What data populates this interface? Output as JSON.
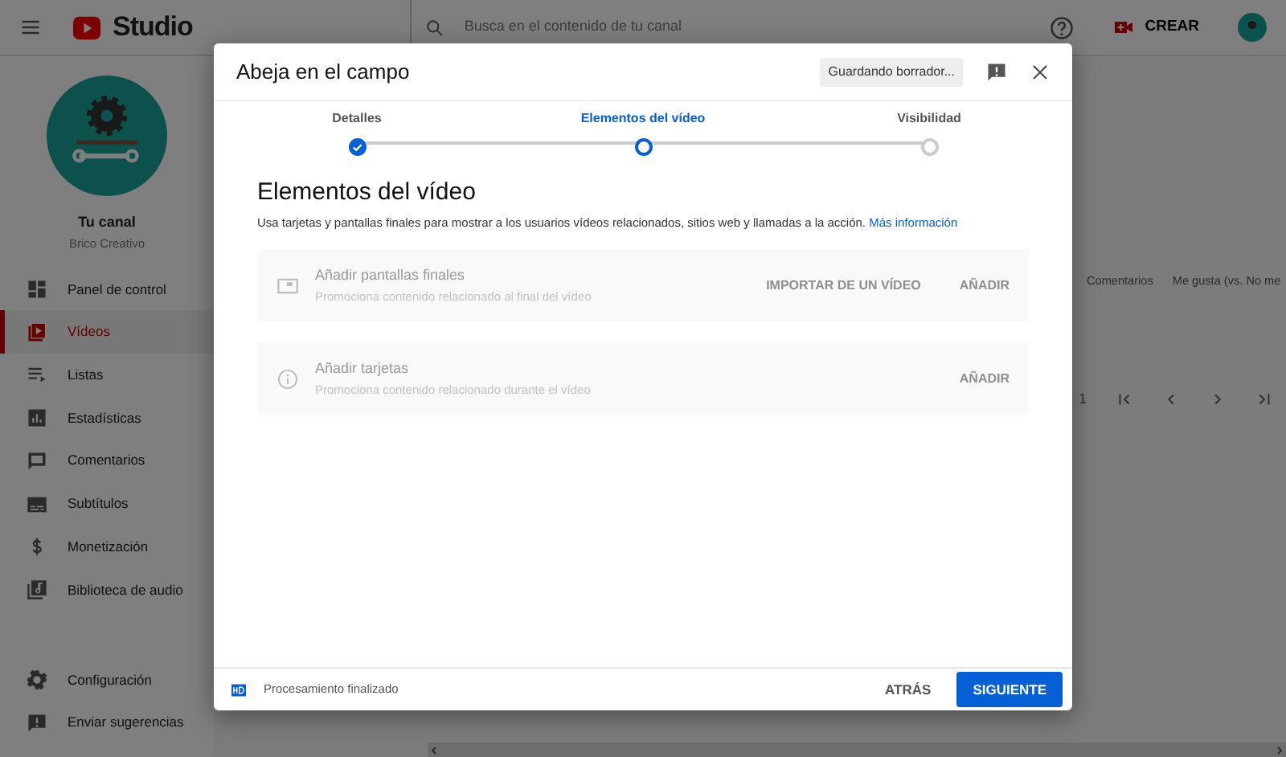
{
  "app": {
    "logo_text": "Studio",
    "search": {
      "placeholder": "Busca en el contenido de tu canal"
    },
    "create_button": "CREAR"
  },
  "channel": {
    "title": "Tu canal",
    "name": "Brico Creativo"
  },
  "sidebar": {
    "items": [
      {
        "label": "Panel de control",
        "selected": false
      },
      {
        "label": "Vídeos",
        "selected": true
      },
      {
        "label": "Listas",
        "selected": false
      },
      {
        "label": "Estadísticas",
        "selected": false
      },
      {
        "label": "Comentarios",
        "selected": false
      },
      {
        "label": "Subtítulos",
        "selected": false
      },
      {
        "label": "Monetización",
        "selected": false
      },
      {
        "label": "Biblioteca de audio",
        "selected": false
      }
    ],
    "bottom_items": [
      {
        "label": "Configuración"
      },
      {
        "label": "Enviar sugerencias"
      }
    ]
  },
  "table": {
    "columns": [
      "Comentarios",
      "Me gusta (vs. No me"
    ],
    "pagination_text": "1"
  },
  "dialog": {
    "title": "Abeja en el campo",
    "save_status": "Guardando borrador...",
    "steps": [
      {
        "label": "Detalles",
        "done": true,
        "selected": false
      },
      {
        "label": "Elementos del vídeo",
        "done": false,
        "selected": true
      },
      {
        "label": "Visibilidad",
        "done": false,
        "selected": false
      }
    ],
    "heading": "Elementos del vídeo",
    "description": "Usa tarjetas y pantallas finales para mostrar a los usuarios vídeos relacionados, sitios web y llamadas a la acción.",
    "learn_more": "Más información",
    "cards": [
      {
        "kind": "end_screen",
        "title": "Añadir pantallas finales",
        "subtitle": "Promociona contenido relacionado al final del vídeo",
        "actions": [
          "IMPORTAR DE UN VÍDEO",
          "AÑADIR"
        ],
        "disabled": true
      },
      {
        "kind": "cards",
        "title": "Añadir tarjetas",
        "subtitle": "Promociona contenido relacionado durante el vídeo",
        "actions": [
          "AÑADIR"
        ],
        "disabled": true
      }
    ],
    "footer": {
      "status": "Procesamiento finalizado",
      "back_button": "ATRÁS",
      "next_button": "SIGUIENTE"
    }
  }
}
